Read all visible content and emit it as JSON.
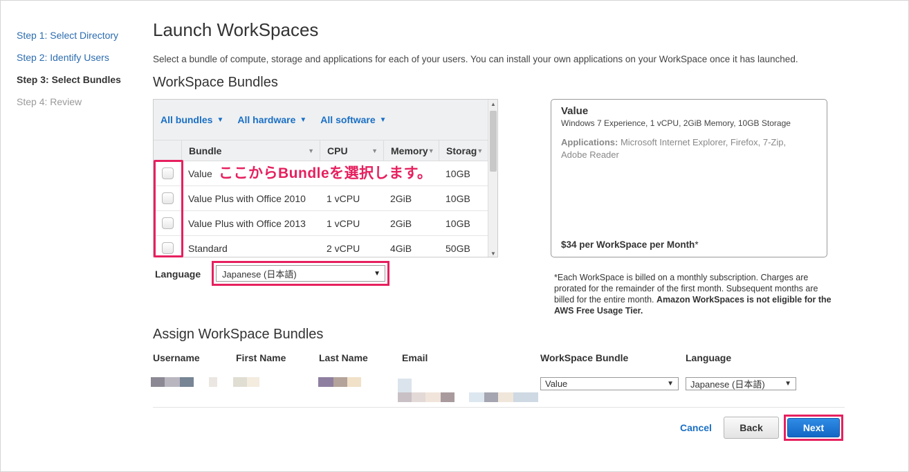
{
  "steps": [
    {
      "label": "Step 1: Select Directory",
      "state": "link"
    },
    {
      "label": "Step 2: Identify Users",
      "state": "link"
    },
    {
      "label": "Step 3: Select Bundles",
      "state": "current"
    },
    {
      "label": "Step 4: Review",
      "state": "disabled"
    }
  ],
  "page_title": "Launch WorkSpaces",
  "intro": "Select a bundle of compute, storage and applications for each of your users. You can install your own applications on your WorkSpace once it has launched.",
  "bundles_section": {
    "heading": "WorkSpace Bundles",
    "filters": [
      "All bundles",
      "All hardware",
      "All software"
    ],
    "columns": [
      "Bundle",
      "CPU",
      "Memory",
      "Storag"
    ],
    "rows": [
      {
        "bundle": "Value",
        "cpu": "",
        "memory": "",
        "storage": "10GB"
      },
      {
        "bundle": "Value Plus with Office 2010",
        "cpu": "1 vCPU",
        "memory": "2GiB",
        "storage": "10GB"
      },
      {
        "bundle": "Value Plus with Office 2013",
        "cpu": "1 vCPU",
        "memory": "2GiB",
        "storage": "10GB"
      },
      {
        "bundle": "Standard",
        "cpu": "2 vCPU",
        "memory": "4GiB",
        "storage": "50GB"
      }
    ],
    "annotation": "ここからBundleを選択します。",
    "language_label": "Language",
    "language_value": "Japanese (日本語)"
  },
  "bundle_card": {
    "title": "Value",
    "specs": "Windows 7 Experience, 1 vCPU, 2GiB Memory, 10GB Storage",
    "apps_label": "Applications:",
    "apps": "Microsoft Internet Explorer, Firefox, 7-Zip, Adobe Reader",
    "price_main": "$34 per WorkSpace per Month",
    "price_suffix": "*"
  },
  "billing_note": {
    "text": "*Each WorkSpace is billed on a monthly subscription. Charges are prorated for the remainder of the first month. Subsequent months are billed for the entire month. ",
    "bold": "Amazon WorkSpaces is not eligible for the AWS Free Usage Tier."
  },
  "assign_section": {
    "heading": "Assign WorkSpace Bundles",
    "columns": [
      "Username",
      "First Name",
      "Last Name",
      "Email",
      "WorkSpace Bundle",
      "Language"
    ],
    "row": {
      "bundle": "Value",
      "language": "Japanese (日本語)"
    }
  },
  "actions": {
    "cancel": "Cancel",
    "back": "Back",
    "next": "Next"
  },
  "colors": {
    "link": "#2b6cb0",
    "accent": "#1a6fc4",
    "highlight": "#e6205f",
    "primary_button": "#1f7ad6"
  }
}
